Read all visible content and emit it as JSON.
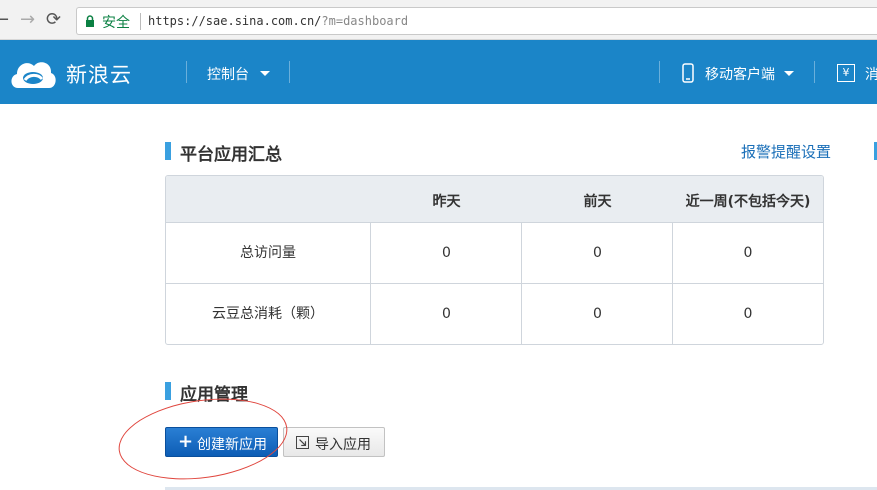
{
  "browser": {
    "back": "←",
    "forward": "→",
    "reload": "⟳",
    "secure_label": "安全",
    "url_main": "https://sae.sina.com.cn/",
    "url_query": "?m=dashboard"
  },
  "topnav": {
    "brand": "新浪云",
    "console": "控制台",
    "mobile": "移动客户端",
    "yuan_icon": "¥",
    "truncated": "消"
  },
  "summary": {
    "title": "平台应用汇总",
    "alert_link": "报警提醒设置",
    "columns": [
      "",
      "昨天",
      "前天",
      "近一周(不包括今天)"
    ],
    "rows": [
      {
        "label": "总访问量",
        "values": [
          "0",
          "0",
          "0"
        ]
      },
      {
        "label": "云豆总消耗（颗）",
        "values": [
          "0",
          "0",
          "0"
        ]
      }
    ]
  },
  "apps": {
    "title": "应用管理",
    "create_button": "创建新应用",
    "import_button": "导入应用"
  },
  "colors": {
    "nav_blue": "#1b85c8",
    "accent": "#3aa0e0",
    "link": "#1a6fb8",
    "annotation": "#e0463e"
  }
}
